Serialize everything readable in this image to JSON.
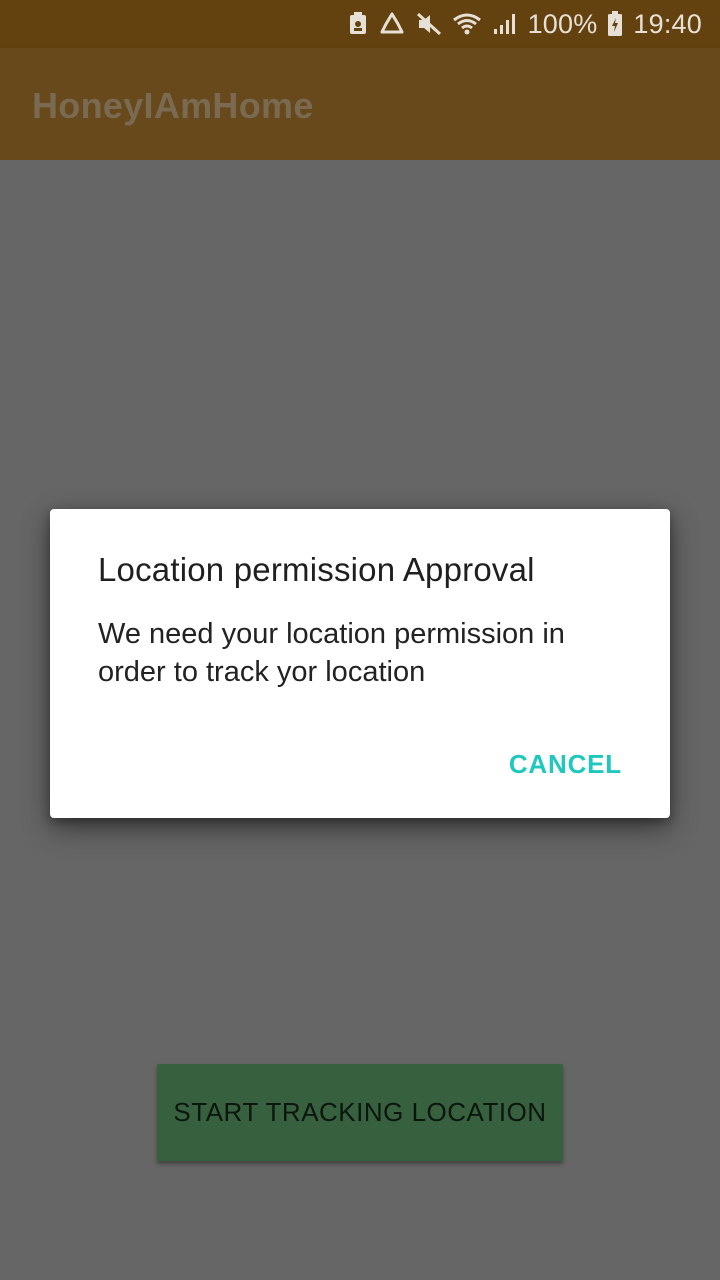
{
  "status_bar": {
    "icons": [
      "android-debug-icon",
      "recycle-icon",
      "mute-icon",
      "wifi-icon",
      "signal-icon",
      "battery-charging-icon"
    ],
    "battery": "100%",
    "time": "19:40"
  },
  "app_bar": {
    "title": "HoneyIAmHome"
  },
  "main": {
    "start_button_label": "START TRACKING LOCATION"
  },
  "dialog": {
    "title": "Location permission Approval",
    "message": "We need your location permission in order to track yor location",
    "cancel_label": "CANCEL"
  },
  "colors": {
    "status_bar": "#64420f",
    "app_bar": "#67491c",
    "scrim_background": "#666666",
    "start_button": "#37603e",
    "accent": "#1fc8bf"
  }
}
